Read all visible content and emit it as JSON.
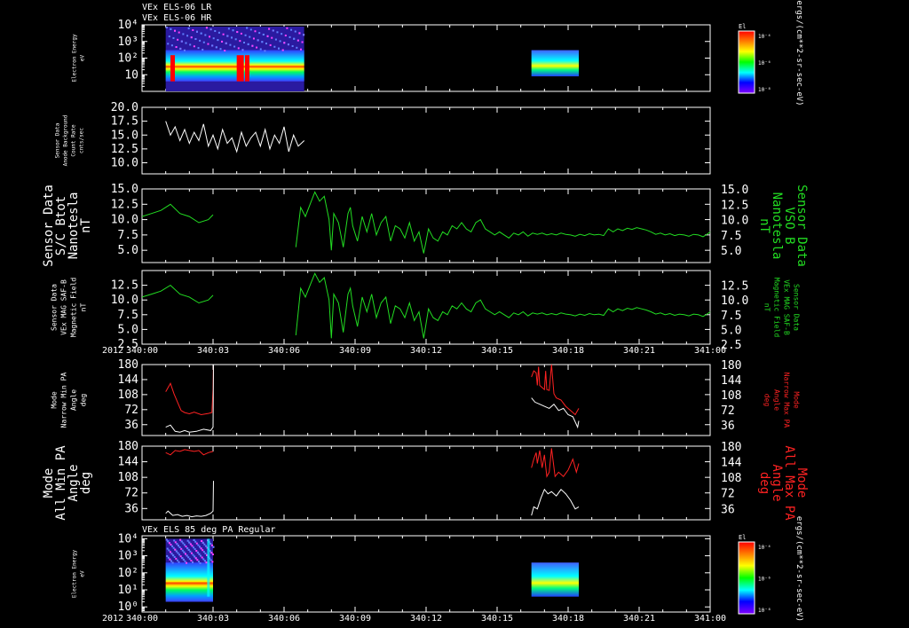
{
  "chart_data": [
    {
      "id": "p1",
      "type": "heatmap",
      "titles": [
        "VEx ELS-06 LR",
        "VEx ELS-06 HR"
      ],
      "ylabel": [
        "Electron Energy",
        "eV"
      ],
      "yscale": "log",
      "ylim": [
        1,
        10000
      ],
      "yticks": [
        {
          "v": 10000,
          "t": "10⁴"
        },
        {
          "v": 1000,
          "t": "10³"
        },
        {
          "v": 100,
          "t": "10²"
        },
        {
          "v": 10,
          "t": "10"
        }
      ],
      "colorbar": {
        "label": "El",
        "ticks": [
          "10⁻⁴",
          "10⁻⁶",
          "10⁻⁸"
        ],
        "unit": "ergs/(cm**2-sr-sec-eV)"
      },
      "blocks": [
        {
          "x0": 1.0,
          "x1": 6.85
        },
        {
          "x0": 16.45,
          "x1": 18.45
        }
      ]
    },
    {
      "id": "p2",
      "type": "line",
      "ylabel": [
        "Sensor Data",
        "Anode Background",
        "Count Rate",
        "cnts/sec"
      ],
      "ylim": [
        8,
        20
      ],
      "yticks": [
        20.0,
        17.5,
        15.0,
        12.5,
        10.0
      ],
      "series": [
        {
          "color": "#ffffff",
          "x": [
            1.0,
            1.2,
            1.4,
            1.6,
            1.8,
            2.0,
            2.2,
            2.4,
            2.6,
            2.8,
            3.0,
            3.2,
            3.4,
            3.6,
            3.8,
            4.0,
            4.2,
            4.4,
            4.6,
            4.8,
            5.0,
            5.2,
            5.4,
            5.6,
            5.8,
            6.0,
            6.2,
            6.4,
            6.6,
            6.85
          ],
          "y": [
            17.5,
            15.0,
            16.5,
            14.0,
            16.0,
            13.5,
            15.5,
            14.0,
            17.0,
            13.0,
            15.0,
            12.5,
            16.0,
            13.5,
            14.5,
            12.0,
            15.5,
            13.0,
            14.5,
            15.5,
            13.0,
            16.0,
            12.5,
            15.0,
            13.5,
            16.5,
            12.0,
            15.0,
            13.0,
            14.0
          ]
        }
      ]
    },
    {
      "id": "p3",
      "type": "line",
      "ylabel": [
        "Sensor Data",
        "S/C Btot",
        "Nanotesla",
        "nT"
      ],
      "ylabel_right": [
        "Sensor Data",
        "VSO B",
        "Nanotesla",
        "nT"
      ],
      "ylim": [
        3,
        15
      ],
      "yticks": [
        15.0,
        12.5,
        10.0,
        7.5,
        5.0
      ],
      "series": [
        {
          "color": "#22dd22",
          "x": [
            0.0,
            0.4,
            0.8,
            1.2,
            1.6,
            2.0,
            2.4,
            2.8,
            3.0
          ],
          "y": [
            10.5,
            11.0,
            11.5,
            12.5,
            11.0,
            10.5,
            9.5,
            10.0,
            10.8
          ]
        },
        {
          "color": "#22dd22",
          "x": [
            6.5,
            6.7,
            6.9,
            7.1,
            7.3,
            7.5,
            7.7,
            7.9,
            8.0,
            8.1,
            8.3,
            8.5,
            8.7,
            8.8,
            8.9,
            9.1,
            9.3,
            9.5,
            9.7,
            9.9,
            10.1,
            10.3,
            10.5,
            10.7,
            10.9,
            11.1,
            11.3,
            11.5,
            11.7,
            11.9,
            12.1,
            12.3,
            12.5,
            12.7,
            12.9,
            13.1,
            13.3,
            13.5,
            13.7,
            13.9,
            14.1,
            14.3,
            14.5,
            14.7,
            14.9,
            15.1,
            15.3,
            15.5,
            15.7,
            15.9,
            16.1,
            16.3,
            16.5,
            16.7,
            16.9,
            17.1,
            17.3,
            17.5,
            17.7,
            17.9,
            18.1,
            18.3,
            18.5,
            18.7,
            18.9,
            19.1,
            19.3,
            19.5,
            19.7,
            19.9,
            20.1,
            20.3,
            20.5,
            20.7,
            20.9,
            21.1,
            21.3,
            21.5,
            21.7,
            21.9,
            22.1,
            22.3,
            22.5,
            22.7,
            22.9,
            23.1,
            23.3,
            23.5,
            23.7,
            23.9,
            24.0
          ],
          "y": [
            5.5,
            12.0,
            10.5,
            12.5,
            14.5,
            13.0,
            13.8,
            10.0,
            5.0,
            11.0,
            9.5,
            5.5,
            11.0,
            12.0,
            9.0,
            6.5,
            10.5,
            8.0,
            11.0,
            7.5,
            9.5,
            10.5,
            6.5,
            9.0,
            8.5,
            7.0,
            9.5,
            6.5,
            8.0,
            4.5,
            8.5,
            7.0,
            6.5,
            8.0,
            7.5,
            9.0,
            8.5,
            9.5,
            8.5,
            8.0,
            9.5,
            10.0,
            8.5,
            8.0,
            7.5,
            8.0,
            7.5,
            7.0,
            7.8,
            7.5,
            8.0,
            7.3,
            7.8,
            7.6,
            7.8,
            7.5,
            7.7,
            7.5,
            7.8,
            7.6,
            7.5,
            7.3,
            7.6,
            7.4,
            7.7,
            7.5,
            7.6,
            7.4,
            8.5,
            8.0,
            8.5,
            8.2,
            8.6,
            8.4,
            8.7,
            8.5,
            8.3,
            8.0,
            7.6,
            7.8,
            7.5,
            7.7,
            7.4,
            7.6,
            7.5,
            7.3,
            7.6,
            7.5,
            7.2,
            7.7,
            8.0
          ]
        }
      ]
    },
    {
      "id": "p4",
      "type": "line",
      "ylabel": [
        "Sensor Data",
        "VEx MAG SAF-B",
        "Magnetic Field",
        "nT"
      ],
      "ylabel_right": [
        "Sensor Data",
        "VEx MAG SAF-B",
        "Magnetic Field",
        "nT"
      ],
      "ylim": [
        2.5,
        15
      ],
      "yticks": [
        12.5,
        10.0,
        7.5,
        5.0,
        2.5
      ],
      "series": [
        {
          "color": "#22dd22",
          "x": [
            0.0,
            0.4,
            0.8,
            1.2,
            1.6,
            2.0,
            2.4,
            2.8,
            3.0
          ],
          "y": [
            10.5,
            11.0,
            11.5,
            12.5,
            11.0,
            10.5,
            9.5,
            10.0,
            10.8
          ]
        },
        {
          "color": "#22dd22",
          "x": [
            6.5,
            6.7,
            6.9,
            7.1,
            7.3,
            7.5,
            7.7,
            7.9,
            8.0,
            8.1,
            8.3,
            8.5,
            8.7,
            8.8,
            8.9,
            9.1,
            9.3,
            9.5,
            9.7,
            9.9,
            10.1,
            10.3,
            10.5,
            10.7,
            10.9,
            11.1,
            11.3,
            11.5,
            11.7,
            11.9,
            12.1,
            12.3,
            12.5,
            12.7,
            12.9,
            13.1,
            13.3,
            13.5,
            13.7,
            13.9,
            14.1,
            14.3,
            14.5,
            14.7,
            14.9,
            15.1,
            15.3,
            15.5,
            15.7,
            15.9,
            16.1,
            16.3,
            16.5,
            16.7,
            16.9,
            17.1,
            17.3,
            17.5,
            17.7,
            17.9,
            18.1,
            18.3,
            18.5,
            18.7,
            18.9,
            19.1,
            19.3,
            19.5,
            19.7,
            19.9,
            20.1,
            20.3,
            20.5,
            20.7,
            20.9,
            21.1,
            21.3,
            21.5,
            21.7,
            21.9,
            22.1,
            22.3,
            22.5,
            22.7,
            22.9,
            23.1,
            23.3,
            23.5,
            23.7,
            23.9,
            24.0
          ],
          "y": [
            4.0,
            12.0,
            10.5,
            12.5,
            14.5,
            13.0,
            13.8,
            10.0,
            3.5,
            11.0,
            9.5,
            4.5,
            11.0,
            12.0,
            9.0,
            5.5,
            10.5,
            8.0,
            11.0,
            7.0,
            9.5,
            10.5,
            6.0,
            9.0,
            8.5,
            7.0,
            9.5,
            6.5,
            8.0,
            3.5,
            8.5,
            7.0,
            6.5,
            8.0,
            7.5,
            9.0,
            8.5,
            9.5,
            8.5,
            8.0,
            9.5,
            10.0,
            8.5,
            8.0,
            7.5,
            8.0,
            7.5,
            7.0,
            7.8,
            7.5,
            8.0,
            7.3,
            7.8,
            7.6,
            7.8,
            7.5,
            7.7,
            7.5,
            7.8,
            7.6,
            7.5,
            7.3,
            7.6,
            7.4,
            7.7,
            7.5,
            7.6,
            7.4,
            8.5,
            8.0,
            8.5,
            8.2,
            8.6,
            8.4,
            8.7,
            8.5,
            8.3,
            8.0,
            7.6,
            7.8,
            7.5,
            7.7,
            7.4,
            7.6,
            7.5,
            7.3,
            7.6,
            7.5,
            7.2,
            7.7,
            8.0
          ]
        }
      ],
      "xaxis": {
        "year": "2012",
        "ticks": [
          {
            "v": 0,
            "t": "340:00"
          },
          {
            "v": 3,
            "t": "340:03"
          },
          {
            "v": 6,
            "t": "340:06"
          },
          {
            "v": 9,
            "t": "340:09"
          },
          {
            "v": 12,
            "t": "340:12"
          },
          {
            "v": 15,
            "t": "340:15"
          },
          {
            "v": 18,
            "t": "340:18"
          },
          {
            "v": 21,
            "t": "340:21"
          },
          {
            "v": 24,
            "t": "341:00"
          }
        ]
      }
    },
    {
      "id": "p5",
      "type": "line",
      "ylabel": [
        "Mode",
        "Narrow Min PA",
        "Angle",
        "deg"
      ],
      "ylabel_right": [
        "Mode",
        "Narrow Max PA",
        "Angle",
        "deg"
      ],
      "ylim": [
        10,
        180
      ],
      "yticks": [
        180,
        144,
        108,
        72,
        36
      ],
      "series": [
        {
          "color": "#ff2222",
          "x": [
            1.0,
            1.2,
            1.35,
            1.5,
            1.65,
            1.8,
            2.0,
            2.2,
            2.5,
            2.8,
            2.95,
            3.0,
            3.02
          ],
          "y": [
            115,
            135,
            110,
            90,
            70,
            65,
            62,
            66,
            60,
            63,
            65,
            120,
            180
          ]
        },
        {
          "color": "#ff2222",
          "x": [
            16.45,
            16.55,
            16.65,
            16.7,
            16.75,
            16.8,
            16.9,
            17.0,
            17.05,
            17.1,
            17.2,
            17.3,
            17.4,
            17.5,
            17.7,
            17.9,
            18.1,
            18.3,
            18.45
          ],
          "y": [
            150,
            165,
            160,
            130,
            175,
            130,
            125,
            120,
            165,
            120,
            118,
            180,
            110,
            100,
            95,
            80,
            70,
            60,
            75
          ]
        },
        {
          "color": "#ffffff",
          "x": [
            1.0,
            1.2,
            1.4,
            1.6,
            1.8,
            2.0,
            2.3,
            2.6,
            2.9,
            3.0,
            3.02
          ],
          "y": [
            30,
            35,
            20,
            18,
            22,
            18,
            20,
            25,
            22,
            30,
            180
          ]
        },
        {
          "color": "#ffffff",
          "x": [
            16.45,
            16.6,
            16.8,
            17.0,
            17.2,
            17.4,
            17.6,
            17.8,
            18.0,
            18.2,
            18.4,
            18.45
          ],
          "y": [
            100,
            90,
            85,
            80,
            75,
            85,
            70,
            75,
            60,
            55,
            30,
            45
          ]
        }
      ]
    },
    {
      "id": "p6",
      "type": "line",
      "ylabel": [
        "Mode",
        "All Min PA",
        "Angle",
        "deg"
      ],
      "ylabel_right": [
        "Mode",
        "All Max PA",
        "Angle",
        "deg"
      ],
      "ylim": [
        10,
        180
      ],
      "yticks": [
        180,
        144,
        108,
        72,
        36
      ],
      "series": [
        {
          "color": "#ff2222",
          "x": [
            1.0,
            1.2,
            1.4,
            1.6,
            1.8,
            2.0,
            2.2,
            2.4,
            2.6,
            2.8,
            3.0
          ],
          "y": [
            165,
            160,
            170,
            168,
            172,
            170,
            168,
            170,
            160,
            165,
            168
          ]
        },
        {
          "color": "#ff2222",
          "x": [
            16.45,
            16.55,
            16.65,
            16.7,
            16.8,
            16.9,
            17.0,
            17.1,
            17.2,
            17.3,
            17.45,
            17.6,
            17.8,
            18.0,
            18.2,
            18.35,
            18.45
          ],
          "y": [
            130,
            150,
            165,
            140,
            170,
            130,
            160,
            110,
            120,
            175,
            110,
            120,
            110,
            125,
            150,
            120,
            140
          ]
        },
        {
          "color": "#ffffff",
          "x": [
            1.0,
            1.1,
            1.3,
            1.5,
            1.7,
            1.9,
            2.1,
            2.3,
            2.5,
            2.7,
            2.9,
            3.0,
            3.02
          ],
          "y": [
            25,
            30,
            20,
            22,
            18,
            20,
            17,
            19,
            18,
            20,
            25,
            30,
            100
          ]
        },
        {
          "color": "#ffffff",
          "x": [
            16.45,
            16.55,
            16.7,
            16.85,
            17.0,
            17.15,
            17.3,
            17.5,
            17.7,
            17.9,
            18.1,
            18.3,
            18.45
          ],
          "y": [
            20,
            40,
            35,
            60,
            80,
            70,
            75,
            65,
            80,
            70,
            55,
            35,
            40
          ]
        }
      ]
    },
    {
      "id": "p7",
      "type": "heatmap",
      "titles": [
        "VEx ELS 85 deg PA Regular"
      ],
      "ylabel": [
        "Electron Energy",
        "eV"
      ],
      "yscale": "log",
      "ylim": [
        0.5,
        15000
      ],
      "yticks": [
        {
          "v": 10000,
          "t": "10⁴"
        },
        {
          "v": 1000,
          "t": "10³"
        },
        {
          "v": 100,
          "t": "10²"
        },
        {
          "v": 10,
          "t": "10¹"
        },
        {
          "v": 1,
          "t": "10⁰"
        }
      ],
      "colorbar": {
        "label": "El",
        "ticks": [
          "10⁻⁴",
          "10⁻⁶",
          "10⁻⁸"
        ],
        "unit": "ergs/(cm**2-sr-sec-eV)"
      },
      "blocks": [
        {
          "x0": 1.0,
          "x1": 3.0
        },
        {
          "x0": 16.45,
          "x1": 18.45
        }
      ],
      "xaxis": {
        "year": "2012",
        "ticks": [
          {
            "v": 0,
            "t": "340:00"
          },
          {
            "v": 3,
            "t": "340:03"
          },
          {
            "v": 6,
            "t": "340:06"
          },
          {
            "v": 9,
            "t": "340:09"
          },
          {
            "v": 12,
            "t": "340:12"
          },
          {
            "v": 15,
            "t": "340:15"
          },
          {
            "v": 18,
            "t": "340:18"
          },
          {
            "v": 21,
            "t": "340:21"
          },
          {
            "v": 24,
            "t": "341:00"
          }
        ]
      }
    }
  ]
}
